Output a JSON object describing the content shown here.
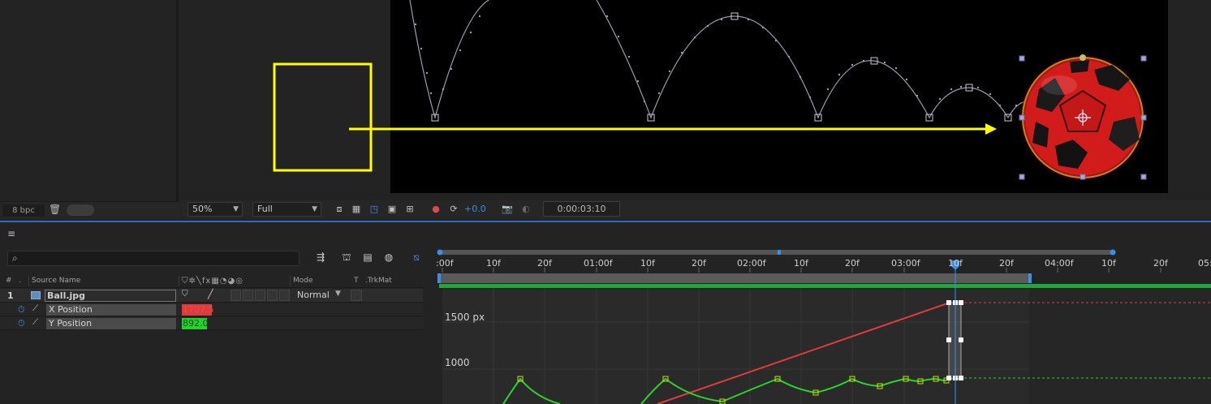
{
  "project": {
    "bit_depth": "8 bpc",
    "trash_icon": "trash-icon"
  },
  "viewer": {
    "zoom": "50%",
    "resolution": "Full",
    "exposure": "+0.0",
    "timecode": "0:00:03:10"
  },
  "timeline": {
    "menu_icon": "≡",
    "search_placeholder": "",
    "columns": {
      "num": "#",
      "source_name": "Source Name",
      "mode": "Mode",
      "t": "T",
      "trkmat": ".TrkMat"
    },
    "layer": {
      "number": "1",
      "name": "Ball.jpg",
      "mode": "Normal"
    },
    "properties": [
      {
        "label": "X Position",
        "value": "1707.5"
      },
      {
        "label": "Y Position",
        "value": "892.0"
      }
    ]
  },
  "ruler": {
    "ticks": [
      ":00f",
      "10f",
      "20f",
      "01:00f",
      "10f",
      "20f",
      "02:00f",
      "10f",
      "20f",
      "03:00f",
      "10f",
      "20f",
      "04:00f",
      "10f",
      "20f",
      "05:"
    ]
  },
  "graph": {
    "axis_labels": [
      "1500 px",
      "1000"
    ],
    "colors": {
      "x_curve": "#e03c3c",
      "y_curve": "#2bd32b",
      "playhead": "#3b8fe8",
      "motion_arrow": "#ffff00"
    }
  }
}
